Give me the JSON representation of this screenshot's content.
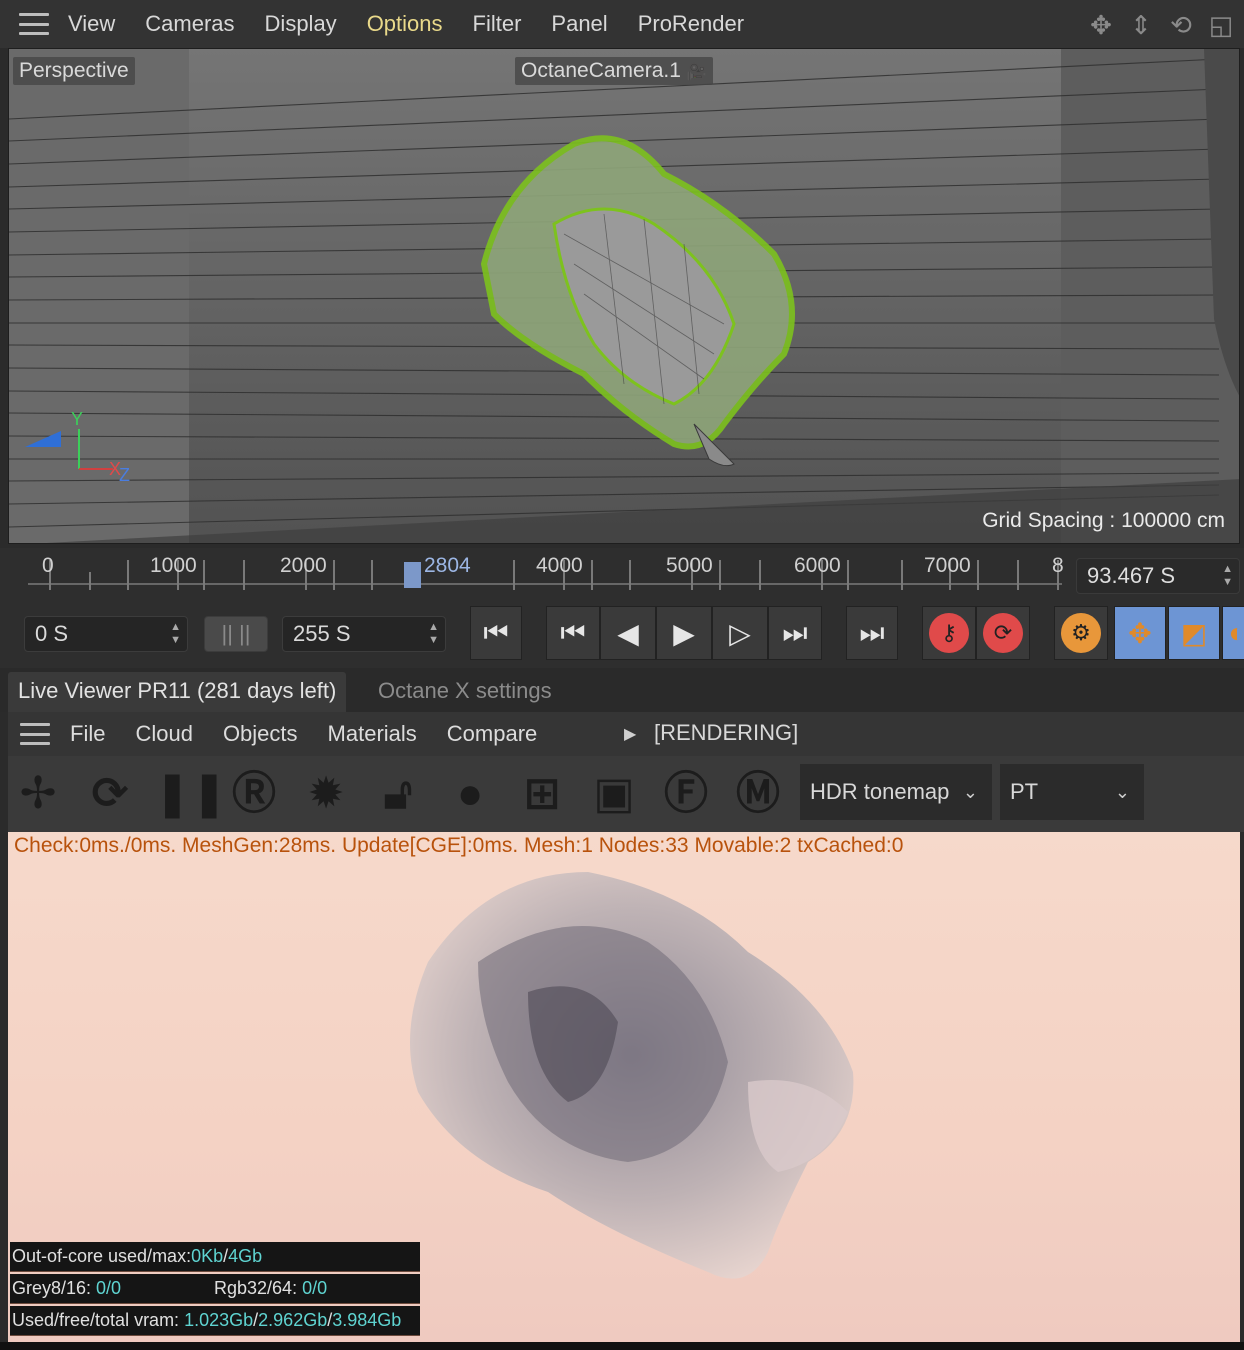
{
  "menubar": {
    "items": [
      "View",
      "Cameras",
      "Display",
      "Options",
      "Filter",
      "Panel",
      "ProRender"
    ],
    "active": "Options"
  },
  "viewport": {
    "view_label": "Perspective",
    "camera_label": "OctaneCamera.1",
    "grid_spacing": "Grid Spacing : 100000 cm",
    "axis": {
      "y": "Y",
      "x": "X",
      "z": "Z"
    }
  },
  "timeline": {
    "ticks": [
      "0",
      "1000",
      "2000",
      "4000",
      "5000",
      "6000",
      "7000",
      "8"
    ],
    "current_frame": "2804",
    "current_time": "93.467 S"
  },
  "transport": {
    "start_time": "0 S",
    "end_time": "255 S"
  },
  "tabs": {
    "active": "Live Viewer PR11 (281 days left)",
    "inactive": "Octane X settings"
  },
  "live_viewer": {
    "menu": [
      "File",
      "Cloud",
      "Objects",
      "Materials",
      "Compare"
    ],
    "status": "[RENDERING]",
    "tonemap": "HDR tonemap",
    "kernel": "PT",
    "check_line": "Check:0ms./0ms. MeshGen:28ms. Update[CGE]:0ms. Mesh:1 Nodes:33 Movable:2 txCached:0",
    "stats": {
      "ooc_label": "Out-of-core used/max:",
      "ooc_used": "0Kb",
      "ooc_max": "4Gb",
      "grey_label": "Grey8/16: ",
      "grey_value": "0/0",
      "rgb_label": "Rgb32/64: ",
      "rgb_value": "0/0",
      "vram_label": "Used/free/total vram: ",
      "vram_used": "1.023Gb",
      "vram_free": "2.962Gb",
      "vram_total": "3.984Gb"
    }
  },
  "colors": {
    "menu_active": "#e9d98a",
    "stat_value": "#5fd4d1",
    "check_text": "#b8520c",
    "render_bg": "#f6d9cb",
    "mesh_green": "#7dc21e"
  }
}
